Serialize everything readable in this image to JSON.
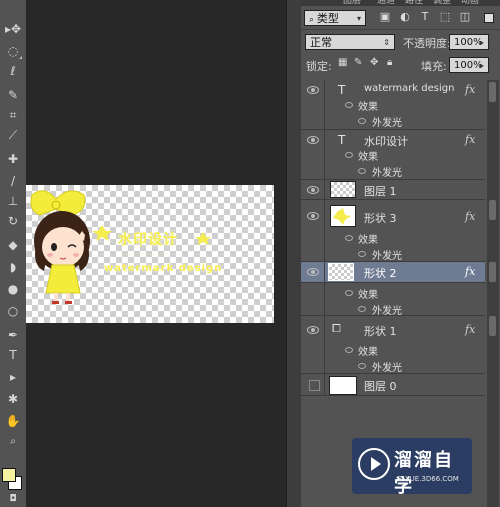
{
  "toolbar": {
    "tools": [
      {
        "name": "move-tool",
        "glyph": "▸✥"
      },
      {
        "name": "marquee-tool",
        "glyph": "◌"
      },
      {
        "name": "lasso-tool",
        "glyph": "ℓ"
      },
      {
        "name": "quick-select-tool",
        "glyph": "✎"
      },
      {
        "name": "crop-tool",
        "glyph": "⌗"
      },
      {
        "name": "eyedropper-tool",
        "glyph": "⟋"
      },
      {
        "name": "healing-brush-tool",
        "glyph": "✚"
      },
      {
        "name": "brush-tool",
        "glyph": "/"
      },
      {
        "name": "clone-stamp-tool",
        "glyph": "⊥"
      },
      {
        "name": "history-brush-tool",
        "glyph": "↻"
      },
      {
        "name": "eraser-tool",
        "glyph": "◆"
      },
      {
        "name": "paint-bucket-tool",
        "glyph": "◗"
      },
      {
        "name": "blur-tool",
        "glyph": "●"
      },
      {
        "name": "dodge-tool",
        "glyph": "○"
      },
      {
        "name": "pen-tool",
        "glyph": "✒"
      },
      {
        "name": "type-tool",
        "glyph": "T"
      },
      {
        "name": "path-select-tool",
        "glyph": "▸"
      },
      {
        "name": "shape-tool",
        "glyph": "✱"
      },
      {
        "name": "hand-tool",
        "glyph": "✋"
      },
      {
        "name": "zoom-tool",
        "glyph": "🔍"
      }
    ],
    "foreground_color": "#f4f1a0",
    "background_color": "#ffffff"
  },
  "canvas": {
    "watermark_title": "水印设计",
    "watermark_text": "watermark design"
  },
  "panel": {
    "tabs": [
      "图层",
      "通道",
      "路径",
      "调整",
      "动画"
    ],
    "filter_kind": "类型",
    "blend_mode": "正常",
    "opacity_label": "不透明度:",
    "opacity_value": "100%",
    "lock_label": "锁定:",
    "fill_label": "填充:",
    "fill_value": "100%"
  },
  "layers": [
    {
      "name": "watermark design",
      "type": "text",
      "effects_label": "效果",
      "effect": "外发光",
      "fx": "fx"
    },
    {
      "name": "水印设计",
      "type": "text",
      "effects_label": "效果",
      "effect": "外发光",
      "fx": "fx"
    },
    {
      "name": "图层 1",
      "type": "pixel"
    },
    {
      "name": "形状 3",
      "type": "shape",
      "effects_label": "效果",
      "effect": "外发光",
      "fx": "fx"
    },
    {
      "name": "形状 2",
      "type": "shape",
      "selected": true,
      "effects_label": "效果",
      "effect": "外发光",
      "fx": "fx"
    },
    {
      "name": "形状 1",
      "type": "shape",
      "effects_label": "效果",
      "effect": "外发光",
      "fx": "fx"
    },
    {
      "name": "图层 0",
      "type": "pixel",
      "hidden": true
    }
  ],
  "badge": {
    "title": "溜溜自学",
    "url": "ZIXUE.3D66.COM"
  }
}
